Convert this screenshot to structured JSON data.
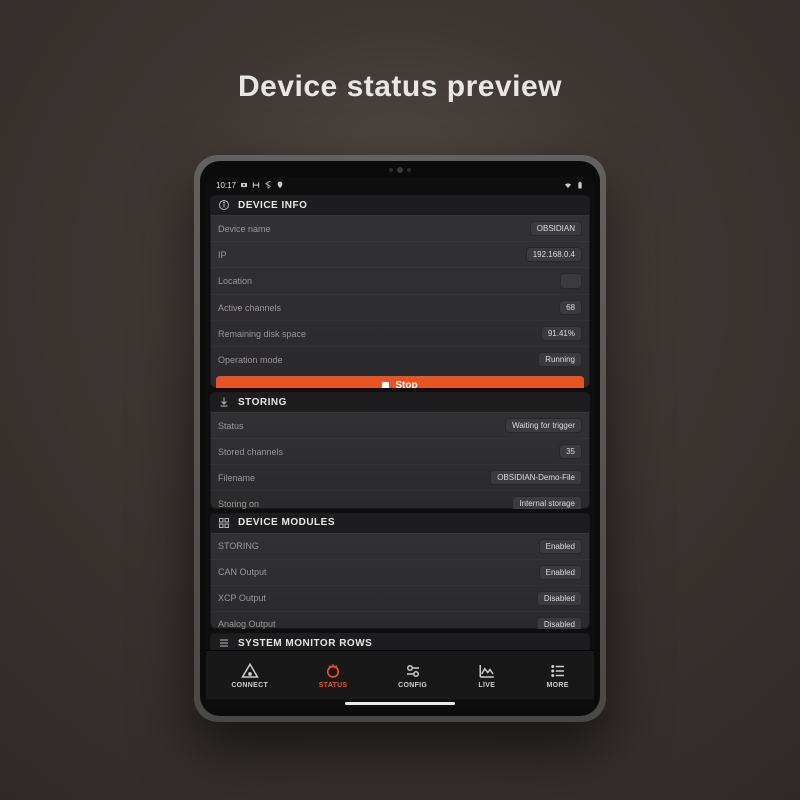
{
  "page_title": "Device status preview",
  "statusbar": {
    "time": "10:17"
  },
  "device_info": {
    "header": "DEVICE INFO",
    "rows": {
      "device_name": {
        "label": "Device name",
        "value": "OBSIDIAN"
      },
      "ip": {
        "label": "IP",
        "value": "192.168.0.4"
      },
      "location": {
        "label": "Location",
        "value": ""
      },
      "active_ch": {
        "label": "Active channels",
        "value": "68"
      },
      "disk": {
        "label": "Remaining disk space",
        "value": "91.41%"
      },
      "mode": {
        "label": "Operation mode",
        "value": "Running"
      }
    },
    "stop_label": "Stop"
  },
  "storing": {
    "header": "STORING",
    "rows": {
      "status": {
        "label": "Status",
        "value": "Waiting for trigger"
      },
      "channels": {
        "label": "Stored channels",
        "value": "35"
      },
      "filename": {
        "label": "Filename",
        "value": "OBSIDIAN-Demo-File"
      },
      "target": {
        "label": "Storing on",
        "value": "Internal storage"
      }
    }
  },
  "modules": {
    "header": "DEVICE MODULES",
    "rows": {
      "storing": {
        "label": "STORING",
        "value": "Enabled"
      },
      "can": {
        "label": "CAN Output",
        "value": "Enabled"
      },
      "xcp": {
        "label": "XCP Output",
        "value": "Disabled"
      },
      "analog": {
        "label": "Analog Output",
        "value": "Disabled"
      }
    }
  },
  "sysmon": {
    "header": "SYSTEM MONITOR ROWS"
  },
  "nav": {
    "connect": "CONNECT",
    "status": "STATUS",
    "config": "CONFIG",
    "live": "LIVE",
    "more": "MORE"
  }
}
